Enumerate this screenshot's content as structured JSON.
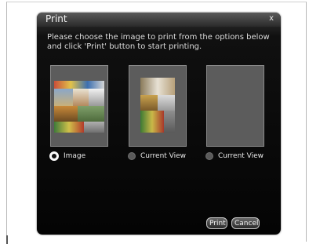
{
  "dialog": {
    "title": "Print",
    "close_label": "x",
    "instructions_line1": "Please choose the image to print from the options below",
    "instructions_line2": "and click 'Print' button to start printing."
  },
  "options": [
    {
      "label": "Image",
      "selected": true
    },
    {
      "label": "Current View",
      "selected": false
    },
    {
      "label": "Current View",
      "selected": false
    }
  ],
  "buttons": {
    "print": "Print",
    "cancel": "Cancel"
  }
}
